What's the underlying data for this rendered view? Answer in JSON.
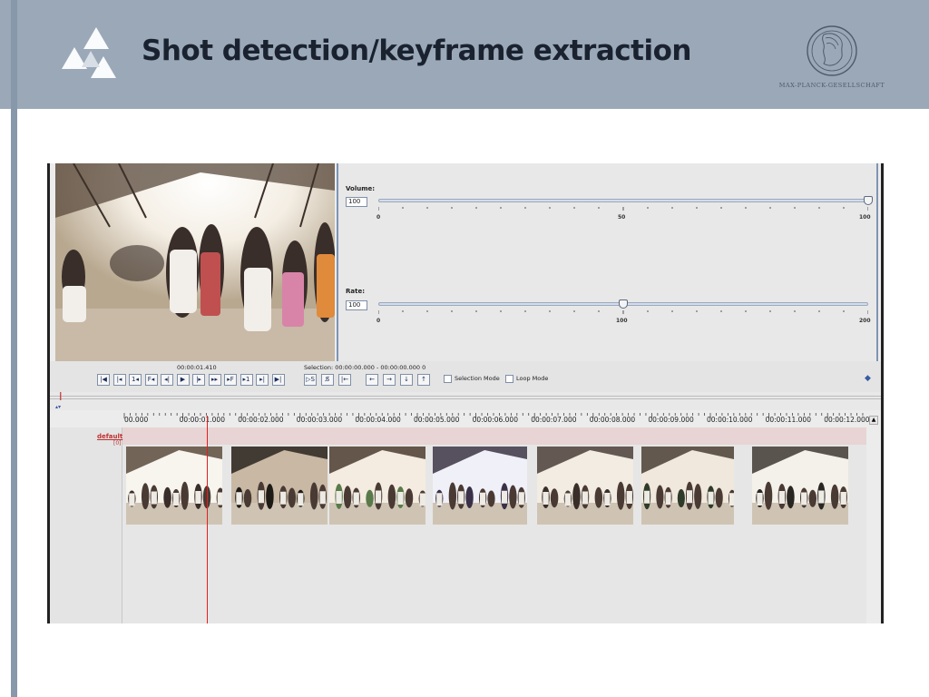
{
  "slide": {
    "title": "Shot detection/keyframe extraction",
    "institute": "MAX-PLANCK-GESELLSCHAFT"
  },
  "player": {
    "volume": {
      "label": "Volume:",
      "value": "100",
      "fraction": 1.0,
      "tick_labels": [
        "0",
        "50",
        "100"
      ]
    },
    "rate": {
      "label": "Rate:",
      "value": "100",
      "fraction": 0.5,
      "tick_labels": [
        "0",
        "100",
        "200"
      ]
    },
    "current_time": "00:00:01.410",
    "selection": "Selection: 00:00:00.000 - 00:00:00.000  0",
    "buttons": [
      {
        "name": "go-to-begin-button",
        "glyph": "|◀"
      },
      {
        "name": "previous-scrollview-button",
        "glyph": "|◂"
      },
      {
        "name": "previous-second-button",
        "glyph": "1◂"
      },
      {
        "name": "previous-frame-button",
        "glyph": "F◂"
      },
      {
        "name": "previous-pixel-button",
        "glyph": "◂|"
      },
      {
        "name": "play-pause-button",
        "glyph": "▶"
      },
      {
        "name": "next-pixel-button",
        "glyph": "|▸"
      },
      {
        "name": "play-selection-button",
        "glyph": "▸▸"
      },
      {
        "name": "next-frame-button",
        "glyph": "▸F"
      },
      {
        "name": "next-second-button",
        "glyph": "▸1"
      },
      {
        "name": "next-scrollview-button",
        "glyph": "▸|"
      },
      {
        "name": "go-to-end-button",
        "glyph": "▶|"
      }
    ],
    "selection_buttons": [
      {
        "name": "play-around-selection-button",
        "glyph": "▷S"
      },
      {
        "name": "clear-selection-button",
        "glyph": "S̸"
      },
      {
        "name": "selection-to-crosshair-button",
        "glyph": "|←"
      }
    ],
    "nav_buttons": [
      {
        "name": "prev-annotation-button",
        "glyph": "←"
      },
      {
        "name": "next-annotation-button",
        "glyph": "→"
      },
      {
        "name": "annotation-down-button",
        "glyph": "↓"
      },
      {
        "name": "annotation-up-button",
        "glyph": "↑"
      }
    ],
    "selection_mode_label": "Selection Mode",
    "loop_mode_label": "Loop Mode"
  },
  "timeline": {
    "ruler_labels": [
      "00.000",
      "00:00:01.000",
      "00:00:02.000",
      "00:00:03.000",
      "00:00:04.000",
      "00:00:05.000",
      "00:00:06.000",
      "00:00:07.000",
      "00:00:08.000",
      "00:00:09.000",
      "00:00:10.000",
      "00:00:11.000",
      "00:00:12.000"
    ],
    "tier_name": "default",
    "tier_sub": "[0]",
    "keyframe_count": 7
  },
  "colors": {
    "header": "#9aa8b8",
    "panel_border": "#7d94b5",
    "playhead": "#e02020",
    "tier_strip": "#e8d4d4"
  }
}
